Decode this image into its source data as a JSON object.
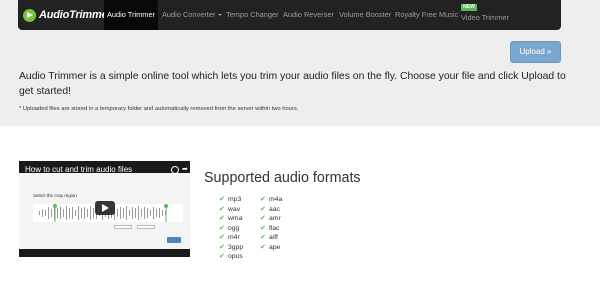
{
  "nav": {
    "brand": "AudioTrimmer",
    "items": [
      {
        "label": "Audio Trimmer",
        "active": true
      },
      {
        "label": "Audio Converter",
        "dropdown": true
      },
      {
        "label": "Tempo Changer"
      },
      {
        "label": "Audio Reverser"
      },
      {
        "label": "Volume Booster"
      },
      {
        "label": "Royalty Free Music"
      },
      {
        "label": "Video Trimmer",
        "badge": "NEW"
      }
    ]
  },
  "upload": {
    "label": "Upload »"
  },
  "intro": "Audio Trimmer is a simple online tool which lets you trim your audio files on the fly. Choose your file and click Upload to get started!",
  "note": "* Uploaded files are stored in a temporary folder and automatically removed from the server within two hours.",
  "video": {
    "title": "How to cut and trim audio files",
    "screen_label": "Select the crop region"
  },
  "formats": {
    "title": "Supported audio formats",
    "col1": [
      "mp3",
      "wav",
      "wma",
      "ogg",
      "m4r",
      "3gpp",
      "opus"
    ],
    "col2": [
      "m4a",
      "aac",
      "amr",
      "flac",
      "aiff",
      "ape"
    ]
  },
  "colors": {
    "navbar": "#222222",
    "accent": "#7aa7d0",
    "check": "#5cb85c",
    "section_bg": "#eeeeee"
  }
}
